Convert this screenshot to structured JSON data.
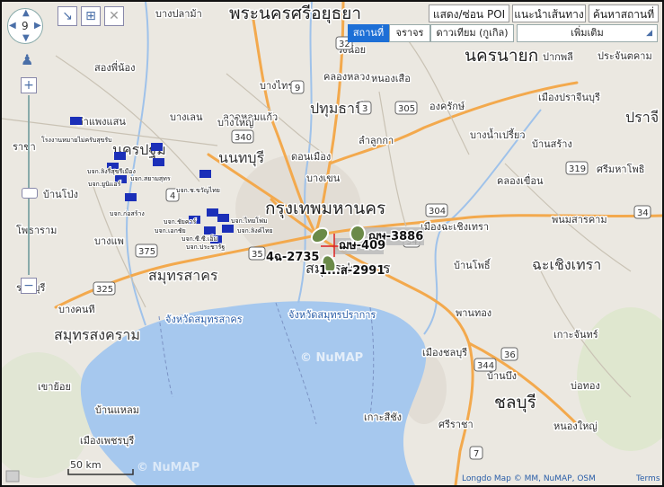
{
  "top_buttons": {
    "poi": "แสดง/ซ่อน POI",
    "route": "แนะนำเส้นทาง",
    "search": "ค้นหาสถานที่"
  },
  "tabs": [
    "สถานที่",
    "จราจร",
    "ดาวเทียม (กูเกิล)"
  ],
  "more_select": "เพิ่มเติม",
  "zoom_level": "9",
  "scale": "50 km",
  "attribution": "Longdo Map © MM, NuMAP, OSM",
  "terms": "Terms",
  "watermark": "© NuMAP",
  "places": {
    "ayutthaya": "พระนครศรีอยุธยา",
    "nakhon_nayok": "นครนายก",
    "pathum_thani": "ปทุมธานี",
    "nonthaburi": "นนทบุรี",
    "bangkok": "กรุงเทพมหานคร",
    "samut_prakan": "สมุทรปราการ",
    "samut_sakhon": "สมุทรสาคร",
    "samut_songkhram": "สมุทรสงคราม",
    "chachoengsao": "ฉะเชิงเทรา",
    "chonburi": "ชลบุรี",
    "nakhon_pathom": "นครปฐม",
    "prachin": "ปราจี",
    "bang_pla_ma": "บางปลาม้า",
    "song_phi_nong": "สองพี่น้อง",
    "wang_noi": "วังน้อย",
    "nong_suea": "หนองเสือ",
    "ongkharak": "องครักษ์",
    "pak_phli": "ปากพลี",
    "prachan_tkham": "ประจันตคาม",
    "mueang_prachin": "เมืองปราจีนบุรี",
    "ban_sang": "บ้านสร้าง",
    "si_maha_phot": "ศรีมหาโพธิ",
    "bang_nam_priao": "บางน้ำเปรี้ยว",
    "khlong_khuean": "คลองเขื่อน",
    "phanom_sarakham": "พนมสารคาม",
    "mueang_chachoeng": "เมืองฉะเชิงเทรา",
    "ban_pho": "บ้านโพธิ์",
    "lam_luk_ka": "ลำลูกกา",
    "khlong_luang": "คลองหลวง",
    "don_mueang": "ดอนเมือง",
    "bang_khen": "บางเขน",
    "bang_sai": "บางไทร",
    "lat_lum_kaeo": "ลาดหลุมแก้ว",
    "bang_len": "บางเลน",
    "kamphaeng_saen": "กำแพงแสน",
    "ban_pong": "บ้านโป่ง",
    "photharam": "โพธาราม",
    "bang_phae": "บางแพ",
    "ratchaburi": "ราชบุรี",
    "bang_khonthi": "บางคนที",
    "wang_yai": "บางใหญ่",
    "khao_yoi": "เขาย้อย",
    "ban_laem": "บ้านแหลม",
    "mueang_phetchaburi": "เมืองเพชรบุรี",
    "mueang_chonburi": "เมืองชลบุรี",
    "phanat": "พานทอง",
    "ko_chan": "เกาะจันทร์",
    "bo_thong": "บ่อทอง",
    "nong_yai": "หนองใหญ่",
    "si_racha": "ศรีราชา",
    "ko_si_chang": "เกาะสีชัง",
    "ban_bueng": "บ้านบึง",
    "ratcha": "ราชา",
    "sea_sakhon": "จังหวัดสมุทรสาคร",
    "sea_prakan": "จังหวัดสมุทรปราการ",
    "ban_bangplama": "บางปลาม้า"
  },
  "vehicles": [
    {
      "plate": "ฌษ-3886"
    },
    {
      "plate": "ฌษ-409"
    },
    {
      "plate": "4ฉ-2735"
    },
    {
      "plate": "1...ส-2991"
    }
  ],
  "poi_labels": [
    "โรงงานหมายไม่ครับสุขรับ",
    "บจก.ลิงรี่สุขรีเมือง",
    "บจก.สยามสุทร",
    "บจก.ยูนิแอร์",
    "บจก.ช.ขวัญไทย",
    "บจก.ก่อสร้าง",
    "บจก.ชัยคาร์",
    "บจก.ไทยโฟม",
    "บจก.เอกชัย",
    "บจก.ลิงค์ไทย",
    "บจก.ซี.ซี.เอ็ม",
    "บจก.ประชารัฐ"
  ],
  "shields": [
    "340",
    "32",
    "305",
    "3",
    "9",
    "34",
    "304",
    "319",
    "35",
    "4",
    "375",
    "325",
    "344",
    "7",
    "36",
    "3"
  ]
}
